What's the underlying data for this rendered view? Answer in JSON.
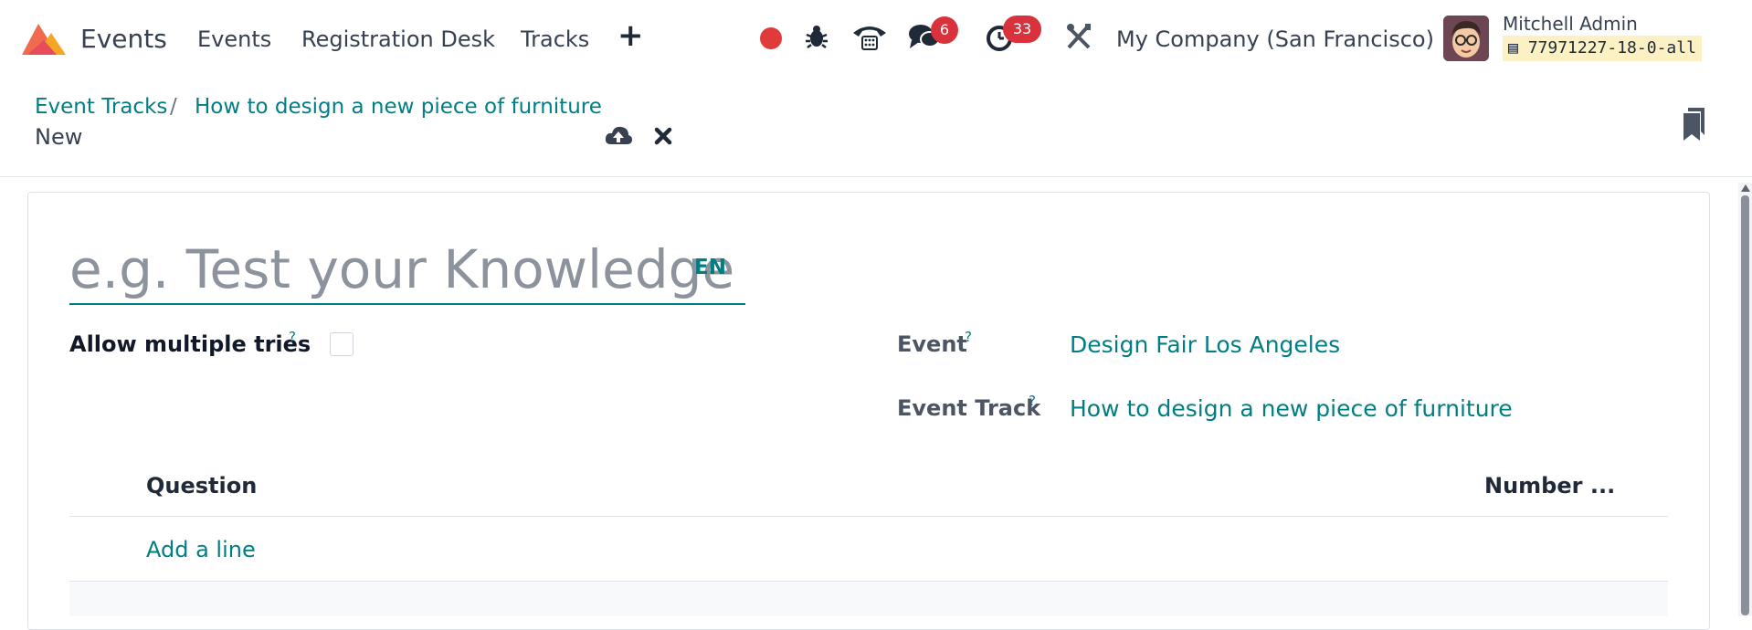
{
  "navbar": {
    "app_name": "Events",
    "menu": [
      "Events",
      "Registration Desk",
      "Tracks"
    ],
    "plus_icon": "plus-icon",
    "messages_count": "6",
    "activities_count": "33",
    "company": "My Company (San Francisco)",
    "user_name": "Mitchell Admin",
    "database": "77971227-18-0-all"
  },
  "breadcrumb": {
    "parent": "Event Tracks",
    "current": "How to design a new piece of furniture",
    "record_status": "New"
  },
  "form": {
    "name_placeholder": "e.g. Test your Knowledge",
    "lang": "EN",
    "allow_multiple_tries_label": "Allow multiple tries",
    "allow_multiple_tries": false,
    "event_label": "Event",
    "event_value": "Design Fair Los Angeles",
    "event_track_label": "Event Track",
    "event_track_value": "How to design a new piece of furniture",
    "help_mark": "?"
  },
  "questions": {
    "columns": [
      "Question",
      "Number ..."
    ],
    "add_line": "Add a line"
  },
  "colors": {
    "accent": "#017e84",
    "badge": "#d9323d",
    "record": "#e03a3a"
  }
}
